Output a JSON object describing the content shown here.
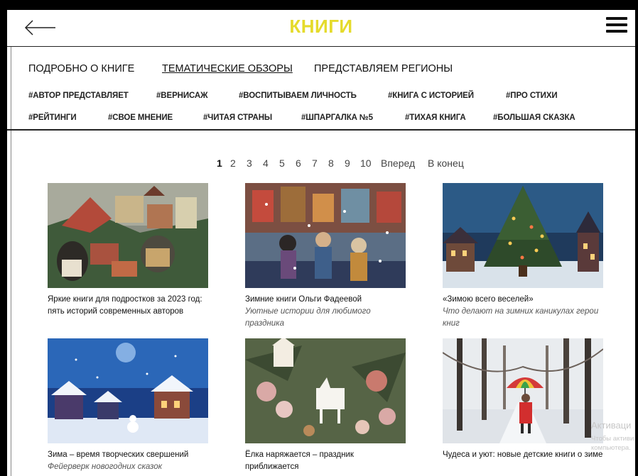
{
  "header": {
    "title": "КНИГИ",
    "back_icon": "arrow-left-icon",
    "menu_icon": "hamburger-icon"
  },
  "nav": [
    {
      "label": "ПОДРОБНО О КНИГЕ",
      "active": false
    },
    {
      "label": "ТЕМАТИЧЕСКИЕ ОБЗОРЫ",
      "active": true
    },
    {
      "label": "ПРЕДСТАВЛЯЕМ РЕГИОНЫ",
      "active": false
    }
  ],
  "tags_row1": [
    "#АВТОР ПРЕДСТАВЛЯЕТ",
    "#ВЕРНИСАЖ",
    "#ВОСПИТЫВАЕМ ЛИЧНОСТЬ",
    "#КНИГА С ИСТОРИЕЙ",
    "#ПРО СТИХИ"
  ],
  "tags_row2": [
    "#РЕЙТИНГИ",
    "#СВОЕ МНЕНИЕ",
    "#ЧИТАЯ СТРАНЫ",
    "#ШПАРГАЛКА №5",
    "#ТИХАЯ КНИГА",
    "#БОЛЬШАЯ СКАЗКА"
  ],
  "pager": {
    "pages": [
      "1",
      "2",
      "3",
      "4",
      "5",
      "6",
      "7",
      "8",
      "9",
      "10"
    ],
    "current": "1",
    "next": "Вперед",
    "last": "В конец"
  },
  "cards": [
    {
      "title": "Яркие книги для подростков за 2023 год: пять историй современных авторов",
      "subtitle": ""
    },
    {
      "title": "Зимние книги Ольги Фадеевой",
      "subtitle": "Уютные истории для любимого праздника"
    },
    {
      "title": "«Зимою всего веселей»",
      "subtitle": "Что делают на зимних каникулах герои книг"
    },
    {
      "title": "Зима – время творческих свершений",
      "subtitle": "Фейерверк новогодних сказок"
    },
    {
      "title": "Ёлка наряжается – праздник приближается",
      "subtitle": ""
    },
    {
      "title": "Чудеса и уют: новые детские книги о зиме",
      "subtitle": ""
    }
  ],
  "watermark": {
    "line1": "Активаци",
    "line2": "Чтобы активи",
    "line3": "компьютера."
  },
  "colors": {
    "title": "#e5db2c",
    "text": "#111111"
  }
}
